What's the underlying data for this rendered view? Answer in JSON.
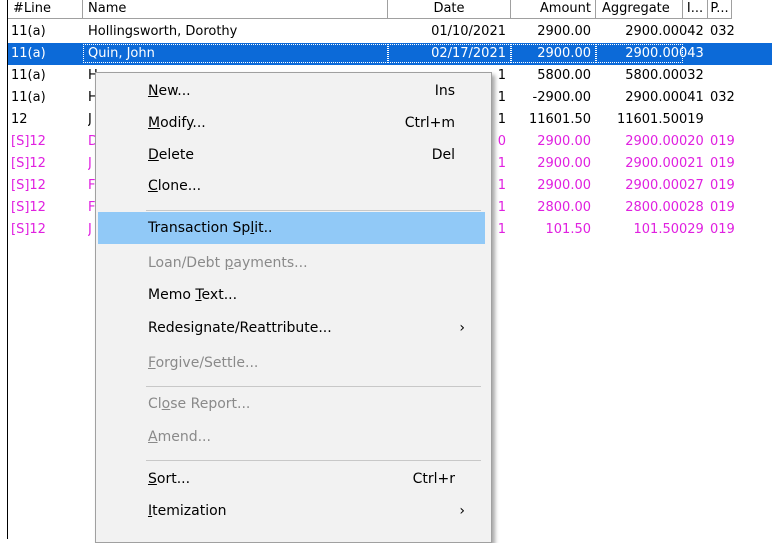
{
  "columns": [
    {
      "key": "line",
      "label": "#Line"
    },
    {
      "key": "name",
      "label": "Name"
    },
    {
      "key": "date",
      "label": "Date"
    },
    {
      "key": "amount",
      "label": "Amount"
    },
    {
      "key": "aggregate",
      "label": "Aggregate"
    },
    {
      "key": "i",
      "label": "I..."
    },
    {
      "key": "p",
      "label": "P..."
    }
  ],
  "rows": [
    {
      "line": "11(a)",
      "name": "Hollingsworth, Dorothy",
      "date": "01/10/2021",
      "amount": "2900.00",
      "aggregate": "2900.00",
      "i": "042",
      "p": "032",
      "style": "normal"
    },
    {
      "line": "11(a)",
      "name": "Quin, John",
      "date": "02/17/2021",
      "amount": "2900.00",
      "aggregate": "2900.00",
      "i": "043",
      "p": "",
      "style": "selected"
    },
    {
      "line": "11(a)",
      "name": "H",
      "date": "1",
      "amount": "5800.00",
      "aggregate": "5800.00",
      "i": "032",
      "p": "",
      "style": "normal"
    },
    {
      "line": "11(a)",
      "name": "H",
      "date": "1",
      "amount": "-2900.00",
      "aggregate": "2900.00",
      "i": "041",
      "p": "032",
      "style": "normal"
    },
    {
      "line": "12",
      "name": "J",
      "date": "1",
      "amount": "11601.50",
      "aggregate": "11601.50",
      "i": "019",
      "p": "",
      "style": "normal"
    },
    {
      "line": "[S]12",
      "name": "D",
      "date": "0",
      "amount": "2900.00",
      "aggregate": "2900.00",
      "i": "020",
      "p": "019",
      "style": "pink"
    },
    {
      "line": "[S]12",
      "name": "J",
      "date": "1",
      "amount": "2900.00",
      "aggregate": "2900.00",
      "i": "021",
      "p": "019",
      "style": "pink"
    },
    {
      "line": "[S]12",
      "name": "F",
      "date": "1",
      "amount": "2900.00",
      "aggregate": "2900.00",
      "i": "027",
      "p": "019",
      "style": "pink"
    },
    {
      "line": "[S]12",
      "name": "F",
      "date": "1",
      "amount": "2800.00",
      "aggregate": "2800.00",
      "i": "028",
      "p": "019",
      "style": "pink"
    },
    {
      "line": "[S]12",
      "name": "J",
      "date": "1",
      "amount": "101.50",
      "aggregate": "101.50",
      "i": "029",
      "p": "019",
      "style": "pink"
    }
  ],
  "menu": {
    "items": [
      {
        "pre": "",
        "acc": "N",
        "post": "ew...",
        "shortcut": "Ins",
        "state": "normal"
      },
      {
        "pre": "",
        "acc": "M",
        "post": "odify...",
        "shortcut": "Ctrl+m",
        "state": "normal"
      },
      {
        "pre": "",
        "acc": "D",
        "post": "elete",
        "shortcut": "Del",
        "state": "normal"
      },
      {
        "pre": "",
        "acc": "C",
        "post": "lone...",
        "shortcut": "",
        "state": "normal"
      },
      {
        "pre": "Transaction Sp",
        "acc": "l",
        "post": "it..",
        "shortcut": "",
        "state": "highlighted"
      },
      {
        "pre": "Loan/Debt ",
        "acc": "p",
        "post": "ayments...",
        "shortcut": "",
        "state": "disabled"
      },
      {
        "pre": "Memo ",
        "acc": "T",
        "post": "ext...",
        "shortcut": "",
        "state": "normal"
      },
      {
        "pre": "Redesignate/Reattribute...",
        "acc": "",
        "post": "",
        "shortcut": "",
        "state": "normal",
        "submenu": true
      },
      {
        "pre": "",
        "acc": "F",
        "post": "orgive/Settle...",
        "shortcut": "",
        "state": "disabled"
      },
      {
        "pre": "Cl",
        "acc": "o",
        "post": "se Report...",
        "shortcut": "",
        "state": "disabled"
      },
      {
        "pre": "",
        "acc": "A",
        "post": "mend...",
        "shortcut": "",
        "state": "disabled"
      },
      {
        "pre": "",
        "acc": "S",
        "post": "ort...",
        "shortcut": "Ctrl+r",
        "state": "normal"
      },
      {
        "pre": "",
        "acc": "I",
        "post": "temization",
        "shortcut": "",
        "state": "normal",
        "submenu": true
      }
    ],
    "submenu_arrow": "›"
  },
  "colors": {
    "selection": "#0c6ad8",
    "split_text": "#e020e0",
    "menu_highlight": "#91c9f7",
    "disabled": "#8a8a8a"
  }
}
